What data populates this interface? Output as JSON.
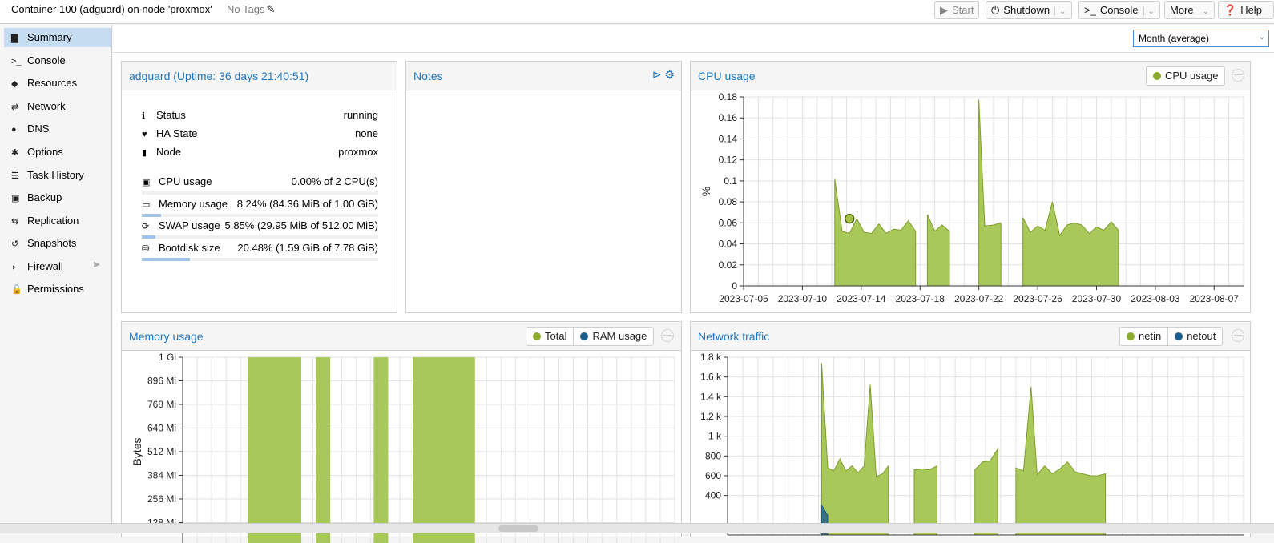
{
  "header": {
    "title": "Container 100 (adguard) on node 'proxmox'",
    "tags": "No Tags",
    "buttons": {
      "start": "Start",
      "shutdown": "Shutdown",
      "console": "Console",
      "more": "More",
      "help": "Help"
    }
  },
  "sidebar": {
    "items": [
      {
        "label": "Summary",
        "icon": "book-icon",
        "glyph": "▇"
      },
      {
        "label": "Console",
        "icon": "terminal-icon",
        "glyph": ">_"
      },
      {
        "label": "Resources",
        "icon": "cube-icon",
        "glyph": "◆"
      },
      {
        "label": "Network",
        "icon": "exchange-icon",
        "glyph": "⇄"
      },
      {
        "label": "DNS",
        "icon": "globe-icon",
        "glyph": "●"
      },
      {
        "label": "Options",
        "icon": "gear-icon",
        "glyph": "✱"
      },
      {
        "label": "Task History",
        "icon": "list-icon",
        "glyph": "☰"
      },
      {
        "label": "Backup",
        "icon": "floppy-icon",
        "glyph": "▣"
      },
      {
        "label": "Replication",
        "icon": "retweet-icon",
        "glyph": "⇆"
      },
      {
        "label": "Snapshots",
        "icon": "history-icon",
        "glyph": "↺"
      },
      {
        "label": "Firewall",
        "icon": "shield-icon",
        "glyph": "◗"
      },
      {
        "label": "Permissions",
        "icon": "unlock-icon",
        "glyph": "🔓"
      }
    ]
  },
  "timeframe": {
    "selected": "Month (average)"
  },
  "status_panel": {
    "title": "adguard (Uptime: 36 days 21:40:51)",
    "status_label": "Status",
    "status_value": "running",
    "ha_label": "HA State",
    "ha_value": "none",
    "node_label": "Node",
    "node_value": "proxmox",
    "cpu_label": "CPU usage",
    "cpu_value": "0.00% of 2 CPU(s)",
    "mem_label": "Memory usage",
    "mem_value": "8.24% (84.36 MiB of 1.00 GiB)",
    "mem_fraction": 0.0824,
    "swap_label": "SWAP usage",
    "swap_value": "5.85% (29.95 MiB of 512.00 MiB)",
    "swap_fraction": 0.0585,
    "disk_label": "Bootdisk size",
    "disk_value": "20.48% (1.59 GiB of 7.78 GiB)",
    "disk_fraction": 0.2048
  },
  "notes_panel": {
    "title": "Notes"
  },
  "cpu_panel": {
    "title": "CPU usage",
    "legend": [
      "CPU usage"
    ]
  },
  "memory_panel": {
    "title": "Memory usage",
    "legend": [
      "Total",
      "RAM usage"
    ]
  },
  "network_panel": {
    "title": "Network traffic",
    "legend": [
      "netin",
      "netout"
    ]
  },
  "colors": {
    "series_green": "#a9c85a",
    "series_line": "#7e9d2b",
    "series_blue": "#1b5c8e",
    "accent": "#1d76c0"
  },
  "chart_data": [
    {
      "type": "area",
      "title": "CPU usage",
      "ylabel": "%",
      "ylim": [
        0,
        0.18
      ],
      "yticks": [
        0,
        0.02,
        0.04,
        0.06,
        0.08,
        0.1,
        0.12,
        0.14,
        0.16,
        0.18
      ],
      "xlim": [
        0,
        34
      ],
      "xtick_positions": [
        0,
        4,
        8,
        12,
        16,
        20,
        24,
        28,
        32
      ],
      "xtick_labels": [
        "2023-07-05",
        "2023-07-10",
        "2023-07-14",
        "2023-07-18",
        "2023-07-22",
        "2023-07-26",
        "2023-07-30",
        "2023-08-03",
        "2023-08-07"
      ],
      "grid": true,
      "series": [
        {
          "name": "CPU usage",
          "segments": [
            [
              [
                6.2,
                0.102
              ],
              [
                6.7,
                0.052
              ],
              [
                7.2,
                0.05
              ],
              [
                7.7,
                0.064
              ],
              [
                8.2,
                0.051
              ],
              [
                8.7,
                0.05
              ],
              [
                9.2,
                0.059
              ],
              [
                9.7,
                0.05
              ],
              [
                10.2,
                0.054
              ],
              [
                10.7,
                0.053
              ],
              [
                11.2,
                0.062
              ],
              [
                11.7,
                0.052
              ]
            ],
            [
              [
                12.5,
                0.068
              ],
              [
                13.0,
                0.052
              ],
              [
                13.5,
                0.058
              ],
              [
                14.0,
                0.052
              ]
            ],
            [
              [
                16.0,
                0.177
              ],
              [
                16.4,
                0.057
              ],
              [
                17.0,
                0.058
              ],
              [
                17.5,
                0.06
              ]
            ],
            [
              [
                19.0,
                0.065
              ],
              [
                19.5,
                0.051
              ],
              [
                20.0,
                0.057
              ],
              [
                20.5,
                0.053
              ],
              [
                21.0,
                0.08
              ],
              [
                21.5,
                0.048
              ],
              [
                22.0,
                0.058
              ],
              [
                22.5,
                0.06
              ],
              [
                23.0,
                0.058
              ],
              [
                23.5,
                0.05
              ],
              [
                24.0,
                0.056
              ],
              [
                24.5,
                0.053
              ],
              [
                25.0,
                0.061
              ],
              [
                25.5,
                0.053
              ]
            ]
          ]
        }
      ],
      "highlight": {
        "x": 7.2,
        "y": 0.064
      }
    },
    {
      "type": "area",
      "title": "Memory usage",
      "ylabel": "Bytes",
      "ylim": [
        0,
        1024
      ],
      "ytick_values": [
        128,
        256,
        384,
        512,
        640,
        768,
        896,
        1024
      ],
      "ytick_labels": [
        "128 Mi",
        "256 Mi",
        "384 Mi",
        "512 Mi",
        "640 Mi",
        "768 Mi",
        "896 Mi",
        "1 Gi"
      ],
      "xlim": [
        0,
        34
      ],
      "grid": true,
      "series": [
        {
          "name": "Total",
          "blocks": [
            [
              4.5,
              8.2,
              1024
            ],
            [
              9.2,
              10.2,
              1024
            ],
            [
              13.2,
              14.2,
              1024
            ],
            [
              15.9,
              20.2,
              1024
            ]
          ]
        }
      ]
    },
    {
      "type": "area",
      "title": "Network traffic",
      "ylim": [
        0,
        1800
      ],
      "ytick_values": [
        400,
        600,
        800,
        1000,
        1200,
        1400,
        1600,
        1800
      ],
      "ytick_labels": [
        "400",
        "600",
        "800",
        "1 k",
        "1.2 k",
        "1.4 k",
        "1.6 k",
        "1.8 k"
      ],
      "xlim": [
        0,
        34
      ],
      "grid": true,
      "series": [
        {
          "name": "netin",
          "segments": [
            [
              [
                6.2,
                1740
              ],
              [
                6.6,
                680
              ],
              [
                7.0,
                650
              ],
              [
                7.4,
                770
              ],
              [
                7.8,
                650
              ],
              [
                8.2,
                700
              ],
              [
                8.6,
                630
              ],
              [
                9.0,
                700
              ],
              [
                9.4,
                1520
              ],
              [
                9.8,
                590
              ],
              [
                10.2,
                620
              ],
              [
                10.6,
                700
              ]
            ],
            [
              [
                12.3,
                660
              ],
              [
                12.8,
                670
              ],
              [
                13.3,
                660
              ],
              [
                13.8,
                700
              ]
            ],
            [
              [
                16.3,
                660
              ],
              [
                16.8,
                740
              ],
              [
                17.3,
                750
              ],
              [
                17.8,
                870
              ]
            ],
            [
              [
                19.0,
                680
              ],
              [
                19.5,
                650
              ],
              [
                20.0,
                1500
              ],
              [
                20.4,
                610
              ],
              [
                20.9,
                700
              ],
              [
                21.4,
                620
              ],
              [
                21.9,
                670
              ],
              [
                22.4,
                740
              ],
              [
                22.9,
                640
              ],
              [
                23.4,
                620
              ],
              [
                23.9,
                600
              ],
              [
                24.4,
                600
              ],
              [
                24.9,
                620
              ]
            ]
          ]
        },
        {
          "name": "netout",
          "segments": [
            [
              [
                6.2,
                300
              ],
              [
                6.6,
                200
              ]
            ]
          ]
        }
      ]
    }
  ]
}
